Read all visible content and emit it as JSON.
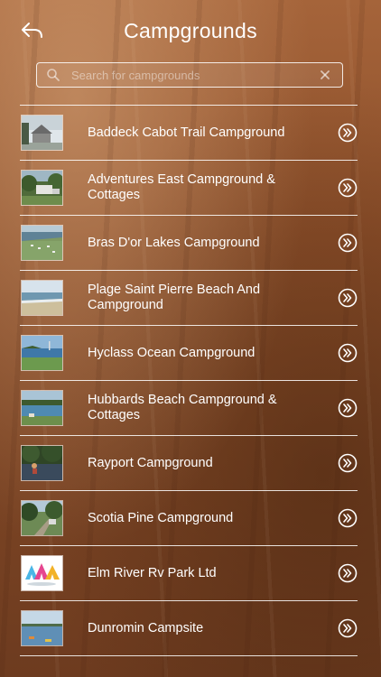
{
  "header": {
    "title": "Campgrounds",
    "back_icon": "back-arrow-icon"
  },
  "search": {
    "placeholder": "Search for campgrounds",
    "value": ""
  },
  "campgrounds": [
    {
      "name": "Baddeck Cabot Trail Campground"
    },
    {
      "name": "Adventures East Campground & Cottages"
    },
    {
      "name": "Bras D'or Lakes Campground"
    },
    {
      "name": "Plage Saint Pierre Beach And Campground"
    },
    {
      "name": "Hyclass Ocean Campground"
    },
    {
      "name": "Hubbards Beach Campground & Cottages"
    },
    {
      "name": "Rayport Campground"
    },
    {
      "name": "Scotia Pine Campground"
    },
    {
      "name": "Elm River Rv Park Ltd"
    },
    {
      "name": "Dunromin Campsite"
    }
  ],
  "colors": {
    "background": "#8d4f2a",
    "text": "#ffffff",
    "divider": "#ffffff"
  }
}
